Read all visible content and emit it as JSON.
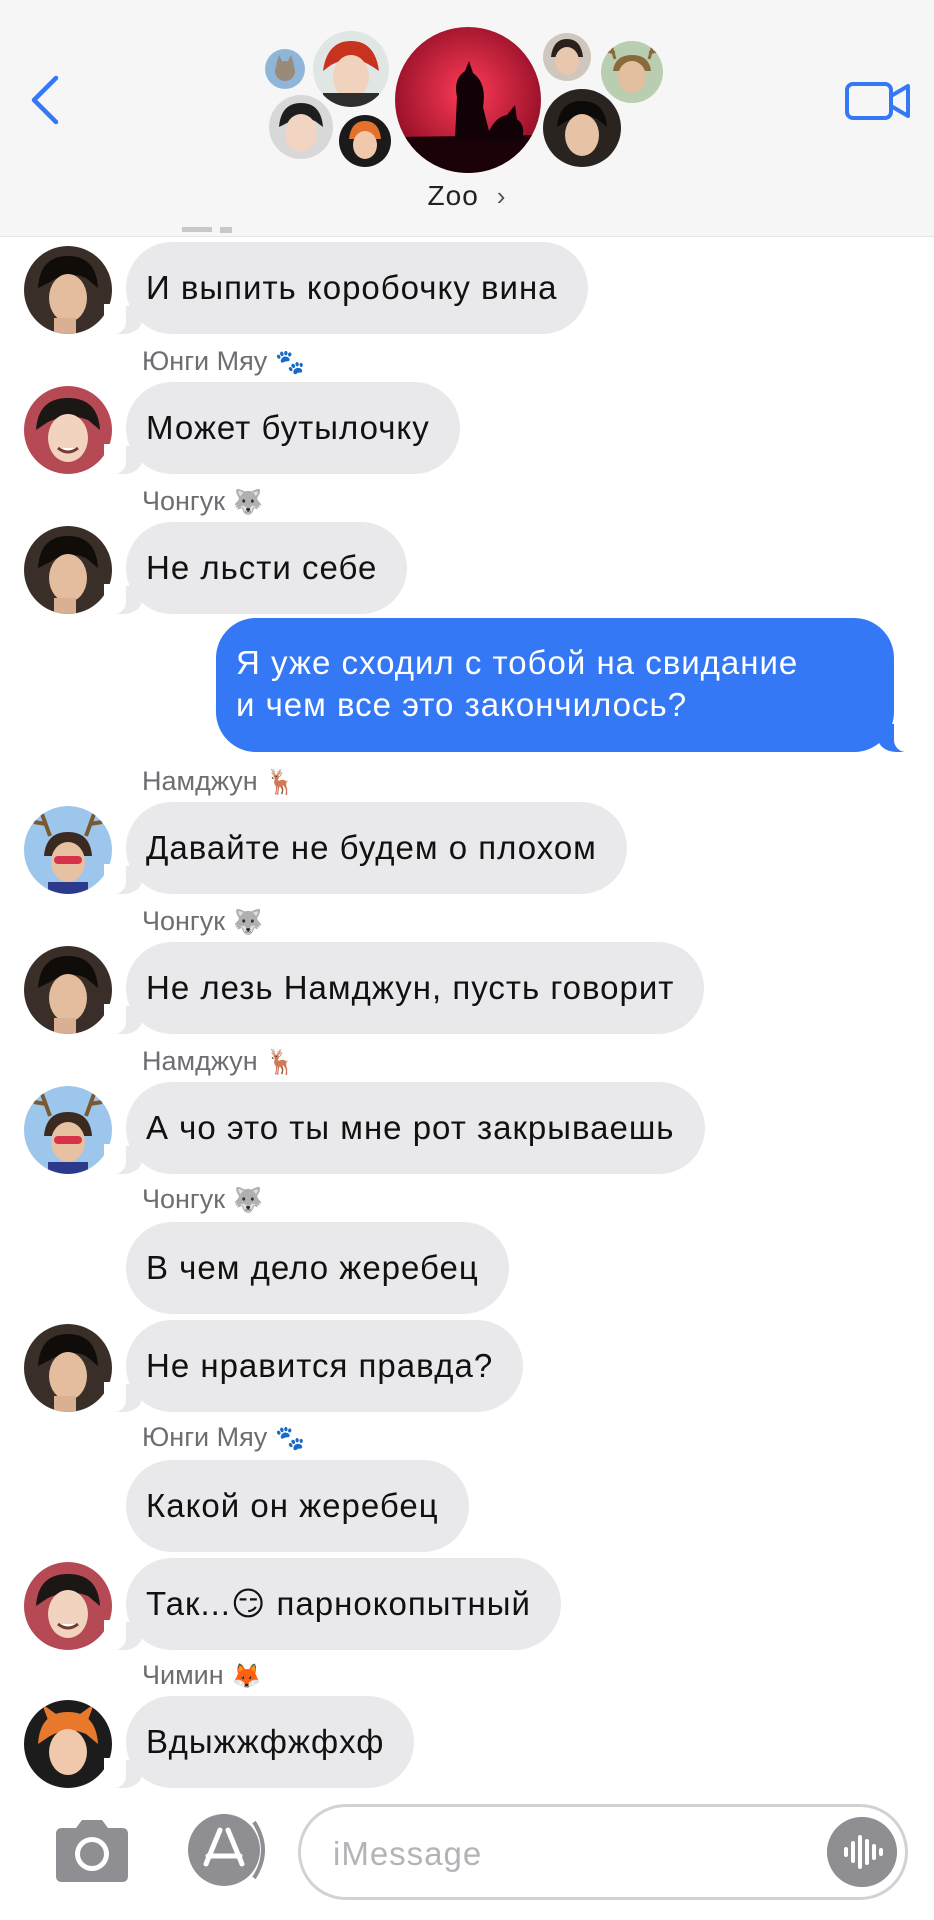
{
  "header": {
    "group_name": "Zoo",
    "chevron": "›",
    "back_icon": "chevron-left-icon",
    "video_icon": "video-camera-icon",
    "accent": "#3478f6"
  },
  "messages": [
    {
      "type": "in",
      "text": "И выпить коробочку вина"
    },
    {
      "type": "sender",
      "name": "Юнги Мяу",
      "emoji": "🐾"
    },
    {
      "type": "in",
      "text": "Может бутылочку"
    },
    {
      "type": "sender",
      "name": "Чонгук",
      "emoji": "🐺"
    },
    {
      "type": "in",
      "text": "Не льсти себе"
    },
    {
      "type": "out",
      "lines": [
        "Я уже сходил с тобой на свидание",
        "и чем все это закончилось?"
      ]
    },
    {
      "type": "sender",
      "name": "Намджун",
      "emoji": "🦌"
    },
    {
      "type": "in",
      "text": "Давайте не будем о плохом"
    },
    {
      "type": "sender",
      "name": "Чонгук",
      "emoji": "🐺"
    },
    {
      "type": "in",
      "text": "Не лезь Намджун,  пусть говорит"
    },
    {
      "type": "sender",
      "name": "Намджун",
      "emoji": "🦌"
    },
    {
      "type": "in",
      "text": "А чо это ты мне рот закрываешь"
    },
    {
      "type": "sender",
      "name": "Чонгук",
      "emoji": "🐺"
    },
    {
      "type": "in",
      "text": "В чем дело жеребец"
    },
    {
      "type": "in",
      "text": "Не нравится правда?"
    },
    {
      "type": "sender",
      "name": "Юнги Мяу",
      "emoji": "🐾"
    },
    {
      "type": "in",
      "text": "Какой он жеребец"
    },
    {
      "type": "in",
      "text": "Так...😏 парнокопытный"
    },
    {
      "type": "sender",
      "name": "Чимин",
      "emoji": "🦊"
    },
    {
      "type": "in",
      "text": "Вдыжжфжфхф"
    }
  ],
  "input": {
    "placeholder": "iMessage",
    "camera_icon": "camera-icon",
    "apps_icon": "app-store-icon",
    "audio_icon": "waveform-icon"
  },
  "colors": {
    "incoming_bubble": "#e9e9eb",
    "outgoing_bubble": "#3478f6",
    "sender_label": "#6d6d72"
  }
}
